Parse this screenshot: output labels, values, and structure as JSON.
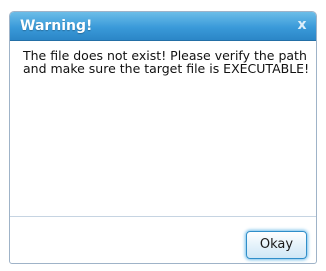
{
  "dialog": {
    "title": "Warning!",
    "close_glyph": "x",
    "close_icon": "close-icon",
    "message": "The file does not exist! Please verify the path and make sure the target file is EXECUTABLE!",
    "okay_label": "Okay"
  },
  "colors": {
    "titlebar": "#3a9ad9",
    "titlebar_light": "#6cbde8",
    "button_border": "#2f8ec9",
    "button_glow": "#73bde9",
    "divider": "#c6d4e2"
  }
}
